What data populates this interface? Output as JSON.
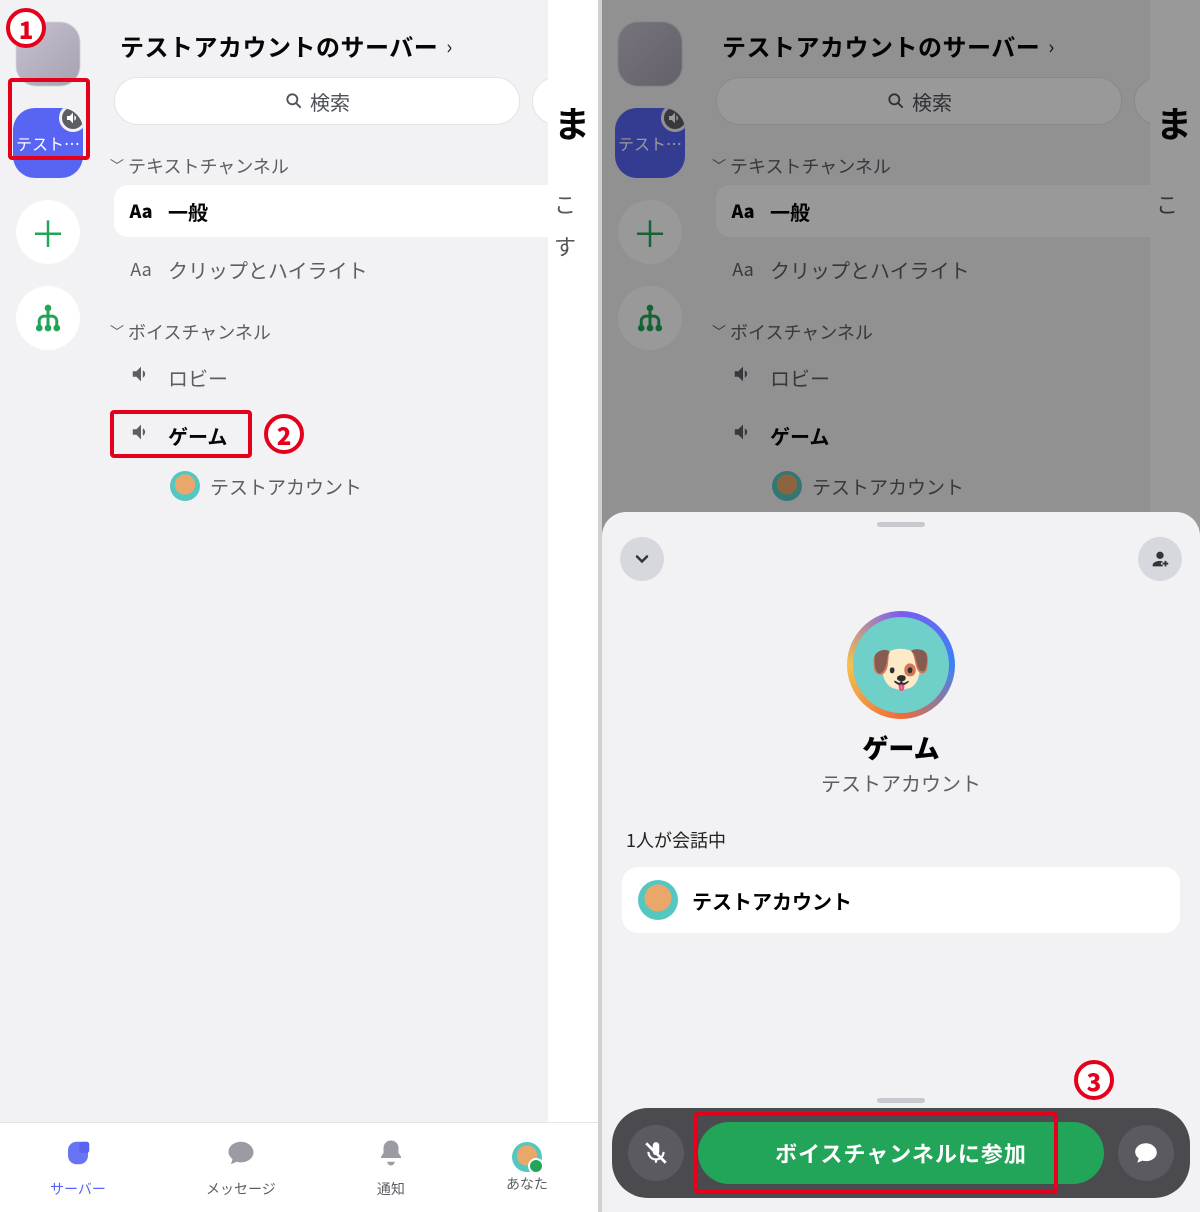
{
  "server": {
    "title": "テストアカウントのサーバー",
    "blob_label": "テスト…"
  },
  "search_placeholder": "検索",
  "sections": {
    "text": {
      "heading": "テキストチャンネル",
      "channels": [
        {
          "label": "一般",
          "icon": "Aa",
          "active": true
        },
        {
          "label": "クリップとハイライト",
          "icon": "Aa",
          "active": false
        }
      ]
    },
    "voice": {
      "heading": "ボイスチャンネル",
      "channels": [
        {
          "label": "ロビー"
        },
        {
          "label": "ゲーム"
        }
      ],
      "member_in_game": "テストアカウント"
    }
  },
  "tabs": {
    "server": "サーバー",
    "message": "メッセージ",
    "notify": "通知",
    "you": "あなた"
  },
  "bg_chat": {
    "a": "ま",
    "b": "こ",
    "c": "す"
  },
  "sheet": {
    "channel_name": "ゲーム",
    "subtitle": "テストアカウント",
    "status": "1人が会話中",
    "member": "テストアカウント",
    "join_label": "ボイスチャンネルに参加"
  },
  "annotations": {
    "one": "1",
    "two": "2",
    "three": "3"
  }
}
